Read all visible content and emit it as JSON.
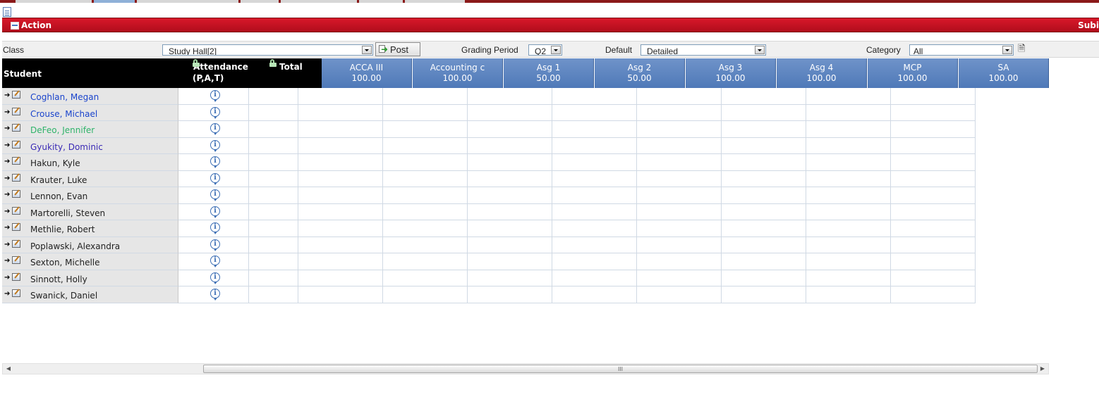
{
  "action_bar": {
    "action_label": "Action",
    "submit_label": "Subi"
  },
  "filters": {
    "class_label": "Class",
    "class_value": "Study Hall[2]",
    "post_label": "Post",
    "grading_period_label": "Grading Period",
    "grading_period_value": "Q2",
    "default_label": "Default",
    "default_value": "Detailed",
    "category_label": "Category",
    "category_value": "All"
  },
  "grid": {
    "header_student": "Student",
    "header_attendance_1": "Attendance",
    "header_attendance_2": "(P,A,T)",
    "header_total": "Total",
    "assignments": [
      {
        "name": "ACCA III",
        "points": "100.00"
      },
      {
        "name": "Accounting c",
        "points": "100.00"
      },
      {
        "name": "Asg 1",
        "points": "50.00"
      },
      {
        "name": "Asg 2",
        "points": "50.00"
      },
      {
        "name": "Asg 3",
        "points": "100.00"
      },
      {
        "name": "Asg 4",
        "points": "100.00"
      },
      {
        "name": "MCP",
        "points": "100.00"
      },
      {
        "name": "SA",
        "points": "100.00"
      }
    ],
    "students": [
      {
        "name": "Coghlan, Megan",
        "color": "#1a44cc"
      },
      {
        "name": "Crouse, Michael",
        "color": "#1a44cc"
      },
      {
        "name": "DeFeo, Jennifer",
        "color": "#2fb36a"
      },
      {
        "name": "Gyukity, Dominic",
        "color": "#3a2ab5"
      },
      {
        "name": "Hakun, Kyle",
        "color": "#222222"
      },
      {
        "name": "Krauter, Luke",
        "color": "#222222"
      },
      {
        "name": "Lennon, Evan",
        "color": "#222222"
      },
      {
        "name": "Martorelli, Steven",
        "color": "#222222"
      },
      {
        "name": "Methlie, Robert",
        "color": "#222222"
      },
      {
        "name": "Poplawski, Alexandra",
        "color": "#222222"
      },
      {
        "name": "Sexton, Michelle",
        "color": "#222222"
      },
      {
        "name": "Sinnott, Holly",
        "color": "#222222"
      },
      {
        "name": "Swanick, Daniel",
        "color": "#222222"
      }
    ]
  },
  "scrollbar": {
    "grip": "III"
  },
  "colors": {
    "accent_red": "#c8101f",
    "header_blue": "#5f86c1"
  }
}
